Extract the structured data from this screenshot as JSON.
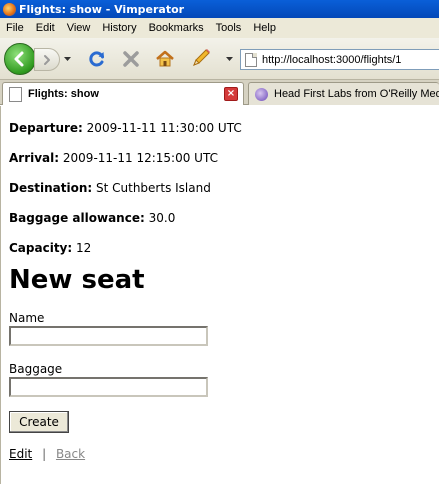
{
  "window": {
    "title": "Flights: show - Vimperator"
  },
  "menu": [
    "File",
    "Edit",
    "View",
    "History",
    "Bookmarks",
    "Tools",
    "Help"
  ],
  "toolbar": {
    "url": "http://localhost:3000/flights/1"
  },
  "tabs": [
    {
      "label": "Flights: show",
      "active": true
    },
    {
      "label": "Head First Labs from O'Reilly Media",
      "active": false
    }
  ],
  "page": {
    "departure": {
      "label": "Departure:",
      "value": "2009-11-11 11:30:00 UTC"
    },
    "arrival": {
      "label": "Arrival:",
      "value": "2009-11-11 12:15:00 UTC"
    },
    "destination": {
      "label": "Destination:",
      "value": "St Cuthberts Island"
    },
    "baggage_allowance": {
      "label": "Baggage allowance:",
      "value": "30.0"
    },
    "capacity": {
      "label": "Capacity:",
      "value": "12"
    },
    "heading": "New seat",
    "form": {
      "name_label": "Name",
      "name_value": "",
      "baggage_label": "Baggage",
      "baggage_value": "",
      "submit_label": "Create"
    },
    "links": {
      "edit": "Edit",
      "separator": "|",
      "back": "Back"
    }
  },
  "colors": {
    "titlebar": "#0a5fd8",
    "chrome": "#ece9d8",
    "back_button": "#2f9a1f",
    "close_tab": "#d43a3a"
  }
}
